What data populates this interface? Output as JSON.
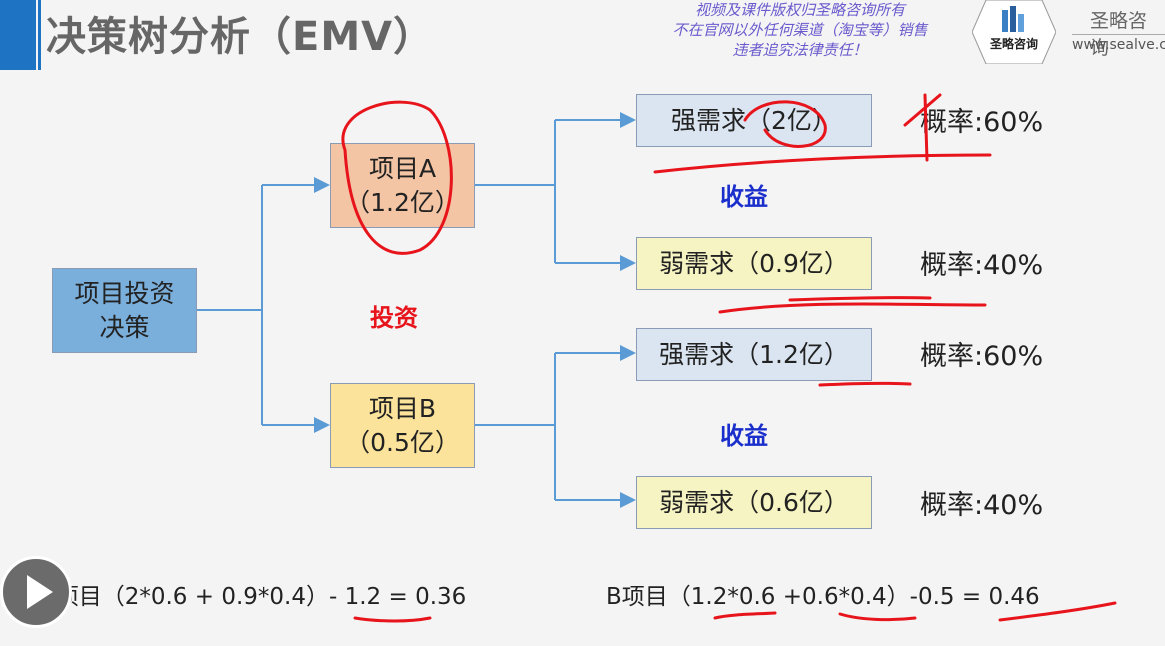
{
  "title": "决策树分析（EMV）",
  "notice": [
    "视频及课件版权归圣略咨询所有",
    "不在官网以外任何渠道（淘宝等）销售",
    "违者追究法律责任！"
  ],
  "brand": {
    "name": "圣略咨询",
    "url": "www.sealve.c",
    "logo_text": "圣略咨询"
  },
  "tree": {
    "root": "项目投资\n决策",
    "invest_label": "投资",
    "gain_label": "收益",
    "project_a": "项目A\n（1.2亿）",
    "project_b": "项目B\n（0.5亿）",
    "a_strong": "强需求（2亿）",
    "a_weak": "弱需求（0.9亿）",
    "b_strong": "强需求（1.2亿）",
    "b_weak": "弱需求（0.6亿）",
    "p_a_strong": "概率:60%",
    "p_a_weak": "概率:40%",
    "p_b_strong": "概率:60%",
    "p_b_weak": "概率:40%"
  },
  "formulas": {
    "a": "A项目（2*0.6 + 0.9*0.4）- 1.2 = 0.36",
    "b": "B项目（1.2*0.6 +0.6*0.4）-0.5 = 0.46"
  },
  "colors": {
    "root": "#7aaedb",
    "a": "#f3c5a5",
    "b": "#fbe39b",
    "strong": "#dbe5f1",
    "weak": "#f6f4c2",
    "line": "#5a9bd5",
    "ink": "#e8141b"
  }
}
